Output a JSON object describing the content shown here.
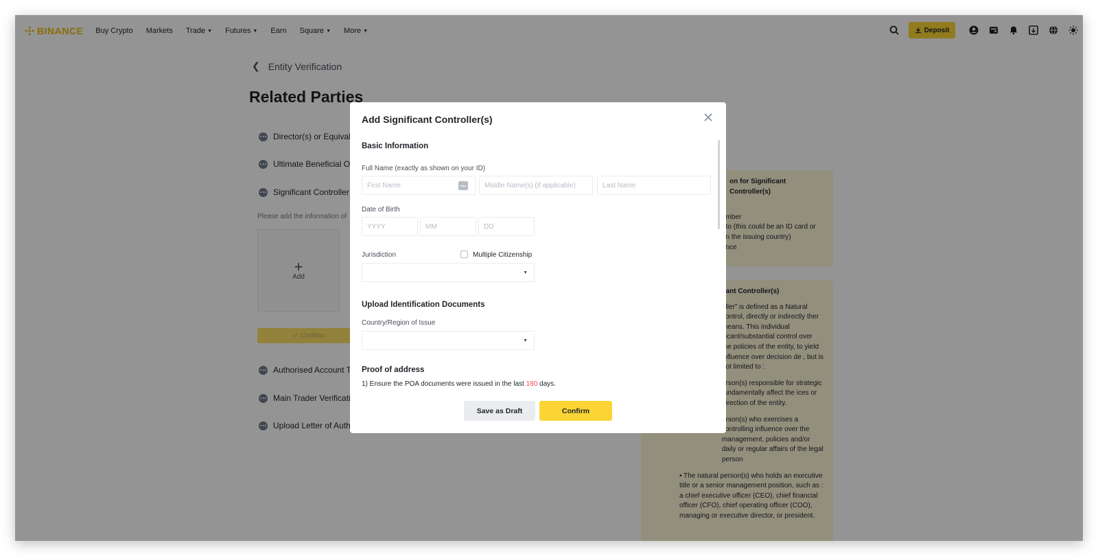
{
  "header": {
    "logo_text": "BINANCE",
    "nav": [
      {
        "label": "Buy Crypto",
        "dropdown": false
      },
      {
        "label": "Markets",
        "dropdown": false
      },
      {
        "label": "Trade",
        "dropdown": true
      },
      {
        "label": "Futures",
        "dropdown": true
      },
      {
        "label": "Earn",
        "dropdown": false
      },
      {
        "label": "Square",
        "dropdown": true
      },
      {
        "label": "More",
        "dropdown": true
      }
    ],
    "deposit_label": "Deposit",
    "icons": [
      "search-icon",
      "download-icon",
      "profile-icon",
      "wallet-icon",
      "bell-icon",
      "transfer-icon",
      "globe-icon",
      "theme-icon"
    ],
    "accent_color": "#fcd535",
    "brand_color": "#f0b90b"
  },
  "page": {
    "back_label": "Entity Verification",
    "title": "Related Parties",
    "steps": [
      "Director(s) or Equival",
      "Ultimate Beneficial O",
      "Significant Controller",
      "Authorised Account T",
      "Main Trader Verificati",
      "Upload Letter of Auth"
    ],
    "hint": "Please add the information of",
    "add_label": "Add",
    "confirm_label": "✓ Confirm"
  },
  "info_panel_1": {
    "title": "on for Significant Controller(s)",
    "items": [
      "n",
      "umber",
      "oto (this could be an ID card or",
      "on the issuing country)",
      "ence",
      "s"
    ]
  },
  "info_panel_2": {
    "title": "cant Controller(s)",
    "paragraphs": [
      "oller” is defined as a Natural control, directly or indirectly ther means. This individual ificant/substantial control over the policies of the entity, to yield influence over decision de , but is not limited to :",
      "erson(s) responsible for strategic fundamentally affect the ices or direction of the entity.",
      "erson(s) who exercises a controlling influence over the management, policies and/or daily or regular affairs of the legal person",
      "The natural person(s) who holds an executive title or a senior management position, such as : a chief executive officer (CEO), chief financial officer (CFO), chief operating officer (COO), managing or executive director, or president."
    ]
  },
  "modal": {
    "title": "Add Significant Controller(s)",
    "basic_info_title": "Basic Information",
    "full_name_label": "Full Name (exactly as shown on your ID)",
    "first_name_placeholder": "First Name",
    "middle_name_placeholder": "Middle Name(s) (if applicable)",
    "last_name_placeholder": "Last Name",
    "dob_label": "Date of Birth",
    "year_placeholder": "YYYY",
    "month_placeholder": "MM",
    "day_placeholder": "DD",
    "jurisdiction_label": "Jurisdiction",
    "multiple_citizenship_label": "Multiple Citizenship",
    "upload_title": "Upload Identification Documents",
    "country_label": "Country/Region of Issue",
    "poa_title": "Proof of address",
    "poa_prefix": "1) Ensure the POA documents were issued in the last ",
    "poa_days": "180",
    "poa_suffix": " days.",
    "save_draft_label": "Save as Draft",
    "confirm_label": "Confirm"
  }
}
